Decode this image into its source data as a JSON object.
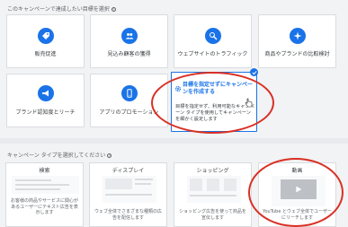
{
  "goals": {
    "heading": "このキャンペーンで達成したい目標を選択",
    "cards": [
      {
        "label": "販売促進",
        "icon": "tag-icon"
      },
      {
        "label": "見込み顧客の獲得",
        "icon": "people-icon"
      },
      {
        "label": "ウェブサイトのトラフィック",
        "icon": "cursor-click-icon"
      },
      {
        "label": "商品やブランドの比較検討",
        "icon": "sparkle-icon"
      },
      {
        "label": "ブランド認知度とリーチ",
        "icon": "megaphone-icon"
      },
      {
        "label": "アプリのプロモーション",
        "icon": "phone-icon"
      }
    ],
    "selected": {
      "title": "目標を指定せずにキャンペーンを作成する",
      "description": "目標を指定せず、利用可能なキャンペーン タイプを使用してキャンペーンを細かく設定します"
    }
  },
  "types": {
    "heading": "キャンペーン タイプを選択してください",
    "cards": [
      {
        "title": "検索",
        "description": "お客様の商品やサービスに関心があるユーザーにテキスト広告を表示します"
      },
      {
        "title": "ディスプレイ",
        "description": "ウェブ全体でさまざまな種類の広告を配信します"
      },
      {
        "title": "ショッピング",
        "description": "ショッピング広告を使って商品を宣伝します"
      },
      {
        "title": "動画",
        "description": "YouTube とウェブ全体でユーザーにリーチします"
      }
    ]
  },
  "colors": {
    "accent": "#1a73e8",
    "highlight": "#d93025"
  }
}
